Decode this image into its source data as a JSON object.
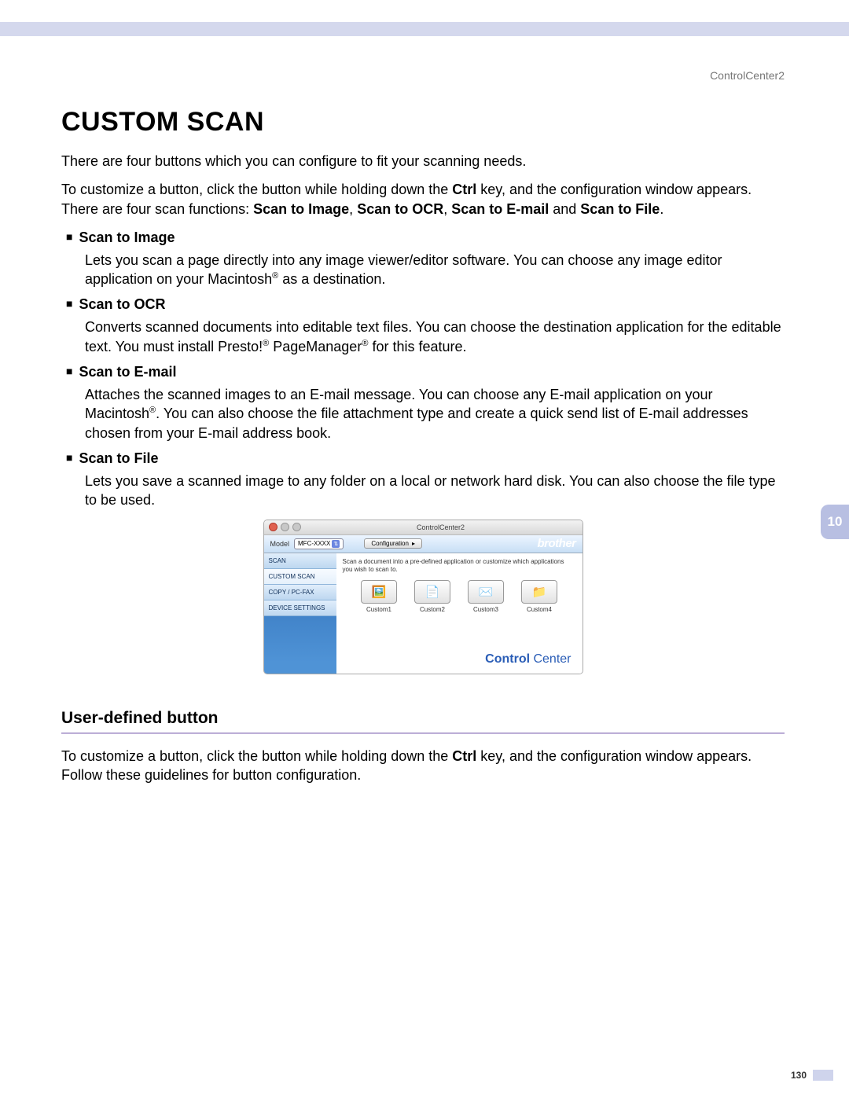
{
  "header": {
    "product": "ControlCenter2"
  },
  "title": "CUSTOM SCAN",
  "intro": {
    "p1": "There are four buttons which you can configure to fit your scanning needs.",
    "p2_pre": "To customize a button, click the button while holding down the ",
    "p2_key": "Ctrl",
    "p2_mid": " key, and the configuration window appears. There are four scan functions: ",
    "p2_f1": "Scan to Image",
    "p2_c1": ", ",
    "p2_f2": "Scan to OCR",
    "p2_c2": ", ",
    "p2_f3": "Scan to E-mail",
    "p2_c3": " and ",
    "p2_f4": "Scan to File",
    "p2_end": "."
  },
  "bullets": [
    {
      "title": "Scan to Image",
      "desc_pre": "Lets you scan a page directly into any image viewer/editor software. You can choose any image editor application on your Macintosh",
      "desc_post": " as a destination."
    },
    {
      "title": "Scan to OCR",
      "desc_pre": "Converts scanned documents into editable text files. You can choose the destination application for the editable text. You must install Presto!",
      "desc_mid": " PageManager",
      "desc_post": " for this feature."
    },
    {
      "title": "Scan to E-mail",
      "desc_pre": "Attaches the scanned images to an E-mail message. You can choose any E-mail application on your Macintosh",
      "desc_post": ". You can also choose the file attachment type and create a quick send list of E-mail addresses chosen from your E-mail address book."
    },
    {
      "title": "Scan to File",
      "desc_pre": "Lets you save a scanned image to any folder on a local or network hard disk. You can also choose the file type to be used.",
      "desc_post": ""
    }
  ],
  "screenshot": {
    "window_title": "ControlCenter2",
    "model_label": "Model",
    "model_value": "MFC-XXXX",
    "config_label": "Configuration",
    "brand": "brother",
    "sidebar": [
      "SCAN",
      "CUSTOM SCAN",
      "COPY / PC-FAX",
      "DEVICE SETTINGS"
    ],
    "hint": "Scan a document into a pre-defined application or customize which applications you wish to scan to.",
    "buttons": [
      {
        "icon": "🖼️",
        "label": "Custom1"
      },
      {
        "icon": "📄",
        "label": "Custom2"
      },
      {
        "icon": "✉️",
        "label": "Custom3"
      },
      {
        "icon": "📁",
        "label": "Custom4"
      }
    ],
    "footer_brand_bold": "Control",
    "footer_brand_light": " Center"
  },
  "section2": {
    "heading": "User-defined button",
    "p_pre": "To customize a button, click the button while holding down the ",
    "p_key": "Ctrl",
    "p_post": " key, and the configuration window appears. Follow these guidelines for button configuration."
  },
  "tab": "10",
  "page_number": "130"
}
